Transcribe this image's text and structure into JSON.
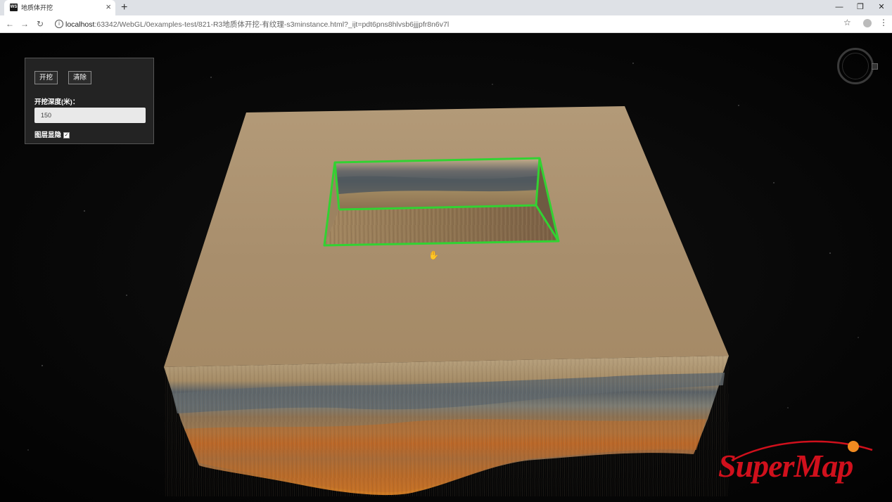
{
  "browser": {
    "tab_title": "地质体开挖",
    "tab_favicon": "WS",
    "new_tab_symbol": "+",
    "url_host": "localhost",
    "url_rest": ":63342/WebGL/0examples-test/821-R3地质体开挖-有纹理-s3minstance.html?_ijt=pdt6pns8hlvsb6jjjpfr8n6v7l",
    "icons": [
      "back-icon",
      "forward-icon",
      "reload-icon",
      "info-icon",
      "star-icon",
      "profile-icon",
      "menu-icon"
    ]
  },
  "panel": {
    "dig_button": "开挖",
    "clear_button": "清除",
    "depth_label": "开挖深度(米)：",
    "depth_value": "150",
    "layer_hide_label": "图层显隐",
    "layer_hide_checked": true
  },
  "brand": {
    "logo_text": "SuperMap",
    "logo_color": "#d0101c",
    "highlight_color": "#32d232"
  }
}
